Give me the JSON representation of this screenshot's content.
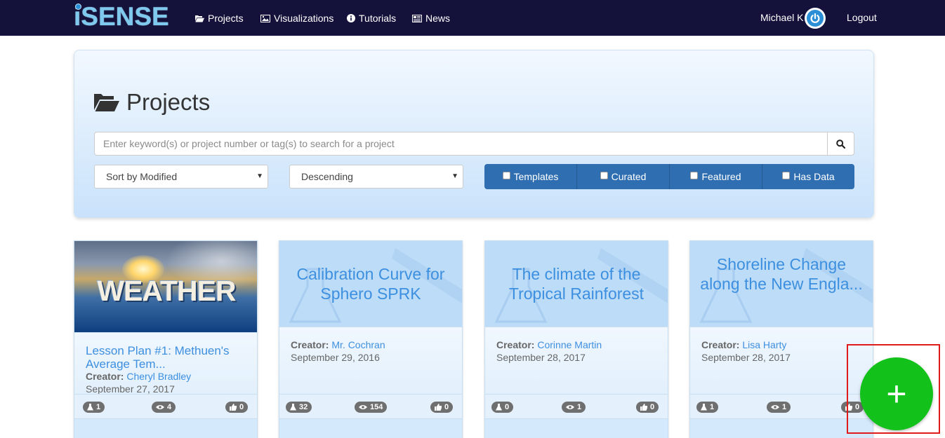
{
  "navbar": {
    "logo": "iSENSE",
    "items": [
      {
        "label": "Projects",
        "icon": "folder-open-icon"
      },
      {
        "label": "Visualizations",
        "icon": "image-icon"
      },
      {
        "label": "Tutorials",
        "icon": "info-circle-icon"
      },
      {
        "label": "News",
        "icon": "newspaper-icon"
      }
    ],
    "user": "Michael K",
    "logout": "Logout"
  },
  "projects_panel": {
    "title": "Projects",
    "search_placeholder": "Enter keyword(s) or project number or tag(s) to search for a project",
    "sort_select": "Sort by Modified",
    "order_select": "Descending",
    "filters": [
      "Templates",
      "Curated",
      "Featured",
      "Has Data"
    ]
  },
  "cards": [
    {
      "image_text": "WEATHER",
      "title": "Lesson Plan #1: Methuen's Average Tem...",
      "creator_label": "Creator:",
      "creator": "Cheryl Bradley",
      "date": "September 27, 2017",
      "datasets": "1",
      "views": "4",
      "likes": "0"
    },
    {
      "title": "Calibration Curve for Sphero SPRK",
      "creator_label": "Creator:",
      "creator": "Mr. Cochran",
      "date": "September 29, 2016",
      "datasets": "32",
      "views": "154",
      "likes": "0"
    },
    {
      "title": "The climate of the Tropical Rainforest",
      "creator_label": "Creator:",
      "creator": "Corinne Martin",
      "date": "September 28, 2017",
      "datasets": "0",
      "views": "1",
      "likes": "0"
    },
    {
      "title": "Shoreline Change along the New Engla...",
      "creator_label": "Creator:",
      "creator": "Lisa Harty",
      "date": "September 28, 2017",
      "datasets": "1",
      "views": "1",
      "likes": "0"
    }
  ],
  "fab": {
    "label": "+"
  },
  "colors": {
    "navbar": "#14123a",
    "filter_button": "#2f6eb1",
    "link": "#3d8fe0",
    "fab": "#12c21a",
    "highlight": "#e01b1b"
  }
}
